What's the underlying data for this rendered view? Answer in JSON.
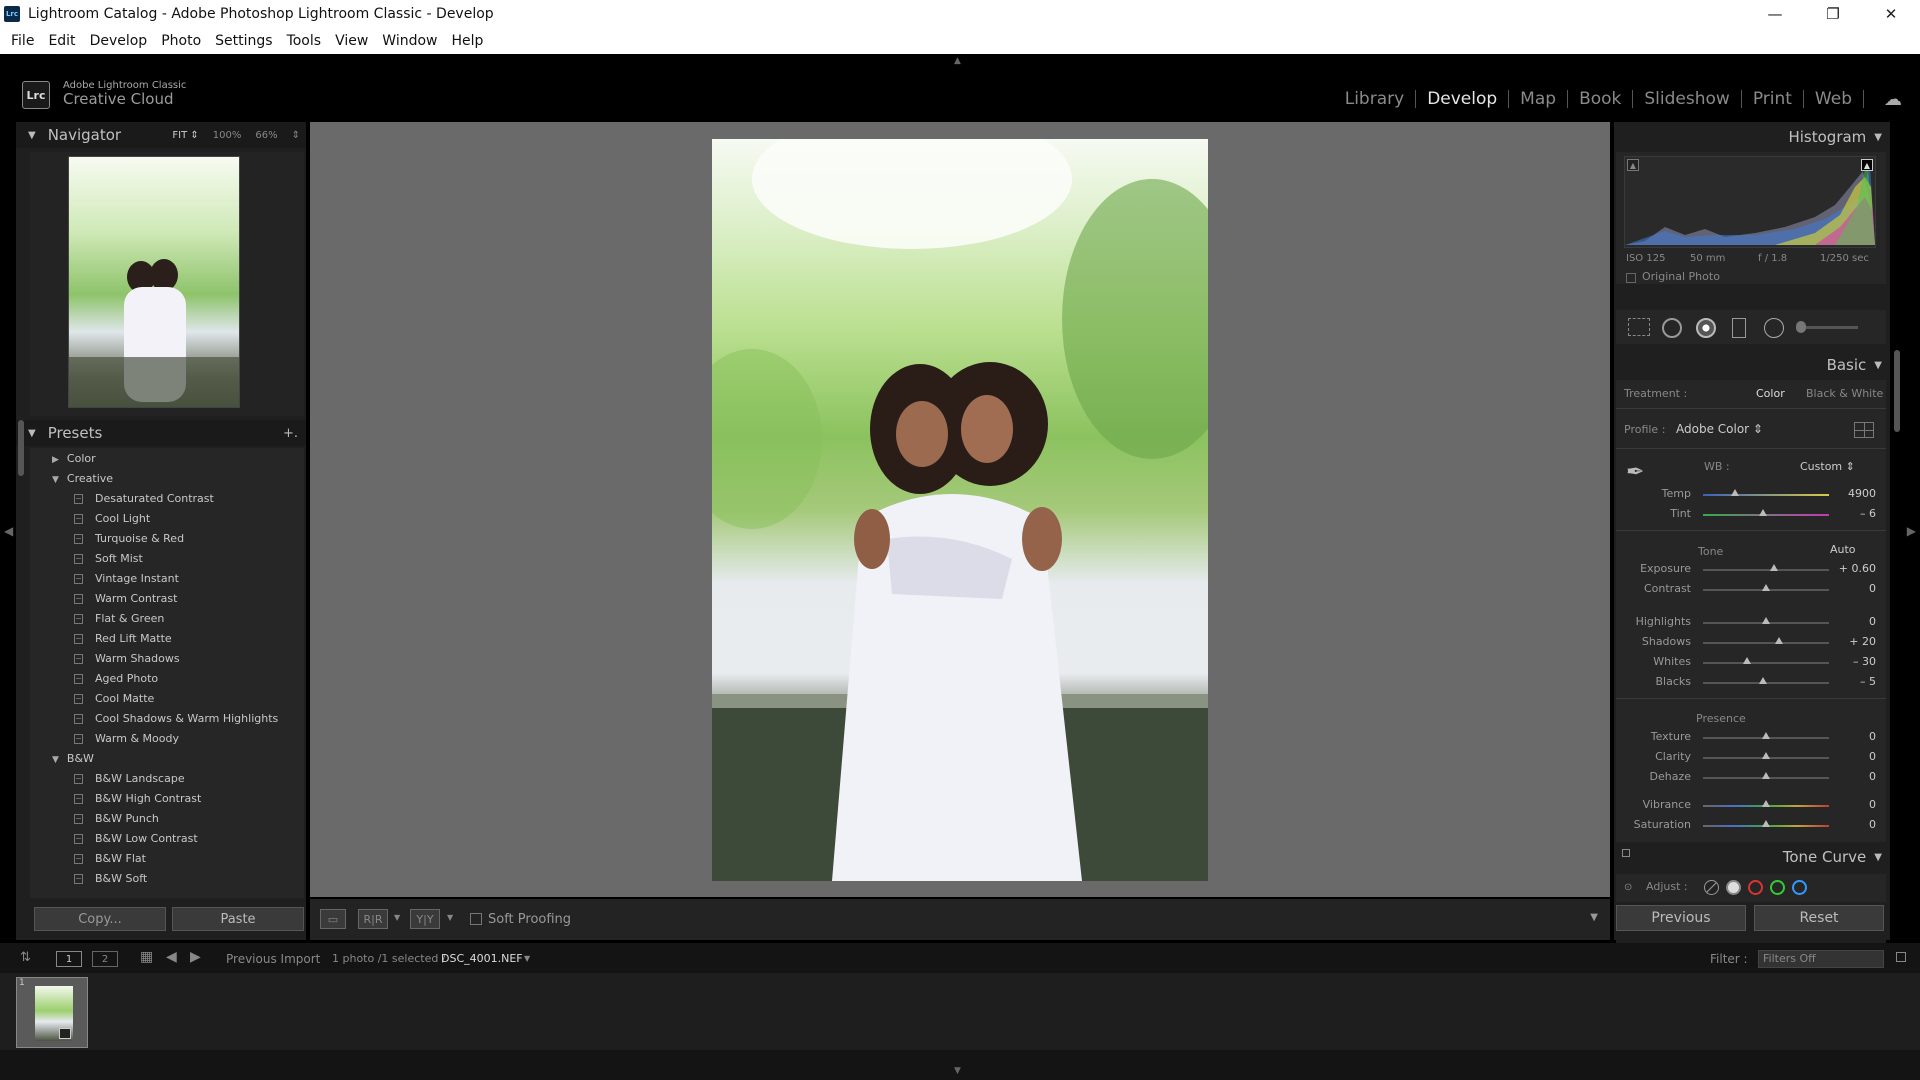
{
  "window": {
    "title": "Lightroom Catalog - Adobe Photoshop Lightroom Classic - Develop",
    "app_icon": "Lrc",
    "controls": [
      "—",
      "❐",
      "✕"
    ]
  },
  "menu": [
    "File",
    "Edit",
    "Develop",
    "Photo",
    "Settings",
    "Tools",
    "View",
    "Window",
    "Help"
  ],
  "identity": {
    "logo": "Lrc",
    "line1": "Adobe Lightroom Classic",
    "line2": "Creative Cloud"
  },
  "modules": [
    {
      "label": "Library",
      "active": false
    },
    {
      "label": "Develop",
      "active": true
    },
    {
      "label": "Map",
      "active": false
    },
    {
      "label": "Book",
      "active": false
    },
    {
      "label": "Slideshow",
      "active": false
    },
    {
      "label": "Print",
      "active": false
    },
    {
      "label": "Web",
      "active": false
    }
  ],
  "navigator": {
    "title": "Navigator",
    "zooms": [
      "FIT ⇕",
      "100%",
      "66%",
      "⇕"
    ]
  },
  "presets": {
    "title": "Presets",
    "add": "+.",
    "groups": [
      {
        "name": "Color",
        "expanded": false,
        "items": []
      },
      {
        "name": "Creative",
        "expanded": true,
        "items": [
          "Desaturated Contrast",
          "Cool Light",
          "Turquoise & Red",
          "Soft Mist",
          "Vintage Instant",
          "Warm Contrast",
          "Flat & Green",
          "Red Lift Matte",
          "Warm Shadows",
          "Aged Photo",
          "Cool Matte",
          "Cool Shadows & Warm Highlights",
          "Warm & Moody"
        ]
      },
      {
        "name": "B&W",
        "expanded": true,
        "items": [
          "B&W Landscape",
          "B&W High Contrast",
          "B&W Punch",
          "B&W Low Contrast",
          "B&W Flat",
          "B&W Soft"
        ]
      }
    ]
  },
  "left_buttons": {
    "copy": "Copy...",
    "paste": "Paste"
  },
  "toolbar": {
    "soft_proofing": "Soft Proofing",
    "view1": "▭",
    "view2": "R|R",
    "view3": "Y|Y"
  },
  "histogram": {
    "title": "Histogram",
    "iso": "ISO 125",
    "focal": "50 mm",
    "aperture": "f / 1.8",
    "shutter": "1/250 sec",
    "original_photo": "Original Photo"
  },
  "basic": {
    "title": "Basic",
    "treatment_label": "Treatment :",
    "treatment_color": "Color",
    "treatment_bw": "Black & White",
    "profile_label": "Profile :",
    "profile_value": "Adobe Color ⇕",
    "wb_label": "WB :",
    "wb_value": "Custom ⇕",
    "wb_sliders": [
      {
        "name": "Temp",
        "value": "4900",
        "pos": 0.25
      },
      {
        "name": "Tint",
        "value": "– 6",
        "pos": 0.48
      }
    ],
    "tone_label": "Tone",
    "auto": "Auto",
    "tone_sliders": [
      {
        "name": "Exposure",
        "value": "+ 0.60",
        "pos": 0.56
      },
      {
        "name": "Contrast",
        "value": "0",
        "pos": 0.5
      }
    ],
    "tone_sliders2": [
      {
        "name": "Highlights",
        "value": "0",
        "pos": 0.5
      },
      {
        "name": "Shadows",
        "value": "+ 20",
        "pos": 0.6
      },
      {
        "name": "Whites",
        "value": "– 30",
        "pos": 0.35
      },
      {
        "name": "Blacks",
        "value": "– 5",
        "pos": 0.475
      }
    ],
    "presence_label": "Presence",
    "presence_sliders": [
      {
        "name": "Texture",
        "value": "0",
        "pos": 0.5
      },
      {
        "name": "Clarity",
        "value": "0",
        "pos": 0.5
      },
      {
        "name": "Dehaze",
        "value": "0",
        "pos": 0.5
      }
    ],
    "presence_sliders2": [
      {
        "name": "Vibrance",
        "value": "0",
        "pos": 0.5
      },
      {
        "name": "Saturation",
        "value": "0",
        "pos": 0.5
      }
    ]
  },
  "tone_curve": {
    "title": "Tone Curve",
    "adjust": "Adjust :"
  },
  "right_buttons": {
    "previous": "Previous",
    "reset": "Reset"
  },
  "filmstrip_bar": {
    "view1": "1",
    "view2": "2",
    "source": "Previous Import",
    "count": "1 photo /1 selected /",
    "filename": "DSC_4001.NEF",
    "filter_label": "Filter :",
    "filter_value": "Filters Off"
  },
  "thumb_index": "1"
}
